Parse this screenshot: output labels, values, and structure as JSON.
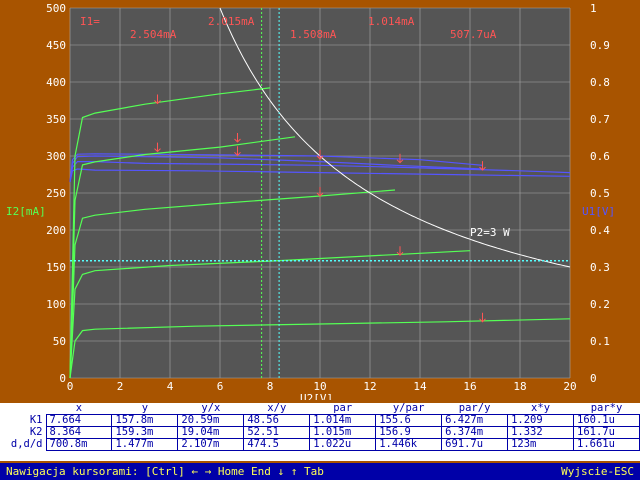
{
  "chart_data": {
    "type": "line",
    "xlabel": "U2[V]",
    "ylabel": "I2[mA]",
    "y2label": "U1[V]",
    "xlim": [
      0,
      20
    ],
    "ylim": [
      0,
      500
    ],
    "y2lim": [
      0,
      1
    ],
    "x_ticks": [
      "0",
      "2",
      "4",
      "6",
      "8",
      "10",
      "12",
      "14",
      "16",
      "18",
      "20"
    ],
    "y_ticks": [
      "0",
      "50",
      "100",
      "150",
      "200",
      "250",
      "300",
      "350",
      "400",
      "450",
      "500"
    ],
    "y2_ticks": [
      "0",
      "0.1",
      "0.2",
      "0.3",
      "0.4",
      "0.5",
      "0.6",
      "0.7",
      "0.8",
      "0.9",
      "1"
    ],
    "grid": true,
    "series_label_prefix": "I1=",
    "series_labels": [
      "2.504mA",
      "2.015mA",
      "1.508mA",
      "1.014mA",
      "507.7uA"
    ],
    "series": [
      {
        "x": [
          0,
          0.2,
          0.5,
          1,
          3,
          6,
          8
        ],
        "values": [
          0,
          300,
          352,
          358,
          370,
          384,
          392
        ]
      },
      {
        "x": [
          0,
          0.2,
          0.5,
          1,
          3,
          6,
          9
        ],
        "values": [
          0,
          240,
          288,
          292,
          302,
          312,
          326
        ]
      },
      {
        "x": [
          0,
          0.2,
          0.5,
          1,
          3,
          6,
          10,
          13
        ],
        "values": [
          0,
          180,
          216,
          220,
          228,
          236,
          246,
          254
        ]
      },
      {
        "x": [
          0,
          0.2,
          0.5,
          1,
          4,
          8,
          12,
          16
        ],
        "values": [
          0,
          120,
          140,
          145,
          152,
          158,
          165,
          172
        ]
      },
      {
        "x": [
          0,
          0.2,
          0.5,
          1,
          5,
          10,
          15,
          20
        ],
        "values": [
          0,
          50,
          64,
          66,
          70,
          73,
          76,
          80
        ]
      }
    ],
    "u1_series": [
      {
        "x": [
          0,
          0.1,
          0.3,
          1,
          3,
          6,
          10,
          14,
          16.5
        ],
        "values": [
          0.53,
          0.59,
          0.605,
          0.606,
          0.605,
          0.603,
          0.6,
          0.59,
          0.575
        ]
      },
      {
        "x": [
          0,
          0.1,
          0.3,
          1,
          3,
          6,
          10,
          13,
          16.5
        ],
        "values": [
          0.53,
          0.58,
          0.598,
          0.6,
          0.598,
          0.595,
          0.585,
          0.575,
          0.565
        ]
      },
      {
        "x": [
          0,
          0.1,
          0.3,
          1,
          3,
          6,
          10,
          13,
          18,
          20
        ],
        "values": [
          0.53,
          0.57,
          0.585,
          0.585,
          0.58,
          0.578,
          0.575,
          0.57,
          0.56,
          0.555
        ]
      },
      {
        "x": [
          0,
          0.1,
          0.3,
          1,
          5,
          10,
          15,
          20
        ],
        "values": [
          0.53,
          0.56,
          0.565,
          0.562,
          0.56,
          0.555,
          0.55,
          0.545
        ]
      }
    ],
    "power_label": "P2=3 W",
    "power_watts": 3,
    "cursor1_x": 7.664,
    "cursor2_x": 8.364,
    "cursor_y": 158.5,
    "markers": [
      {
        "x": 3.5,
        "y": 375
      },
      {
        "x": 6.7,
        "y": 323
      },
      {
        "x": 3.5,
        "y": 310
      },
      {
        "x": 6.7,
        "y": 305
      },
      {
        "x": 10,
        "y": 300
      },
      {
        "x": 10,
        "y": 250
      },
      {
        "x": 13.2,
        "y": 295
      },
      {
        "x": 16.5,
        "y": 285
      },
      {
        "x": 13.2,
        "y": 170
      },
      {
        "x": 16.5,
        "y": 80
      }
    ],
    "colors": {
      "plot_bg": "#555555",
      "grid": "#a8a8a8",
      "i2_curves": "#55ff55",
      "u1_curves": "#5555ff",
      "power_curve": "#ffffff",
      "cursor": "#55ffff",
      "marker": "#ff5555",
      "series_labels": "#ff5555",
      "axis_text": "#ffffff",
      "left_label": "#55ff55",
      "right_label": "#5555ff"
    }
  },
  "table": {
    "headers": [
      "x",
      "y",
      "y/x",
      "x/y",
      "par",
      "y/par",
      "par/y",
      "x*y",
      "par*y"
    ],
    "rows": [
      {
        "label": "K1",
        "values": [
          "7.664",
          "157.8m",
          "20.59m",
          "48.56",
          "1.014m",
          "155.6",
          "6.427m",
          "1.209",
          "160.1u"
        ]
      },
      {
        "label": "K2",
        "values": [
          "8.364",
          "159.3m",
          "19.04m",
          "52.51",
          "1.015m",
          "156.9",
          "6.374m",
          "1.332",
          "161.7u"
        ]
      },
      {
        "label": "d,d/d",
        "values": [
          "700.8m",
          "1.477m",
          "2.107m",
          "474.5",
          "1.022u",
          "1.446k",
          "691.7u",
          "123m",
          "1.661u"
        ]
      }
    ]
  },
  "status": {
    "left": "Nawigacja kursorami: [Ctrl] ← → Home End ↓ ↑ Tab",
    "right": "Wyjscie-ESC"
  }
}
